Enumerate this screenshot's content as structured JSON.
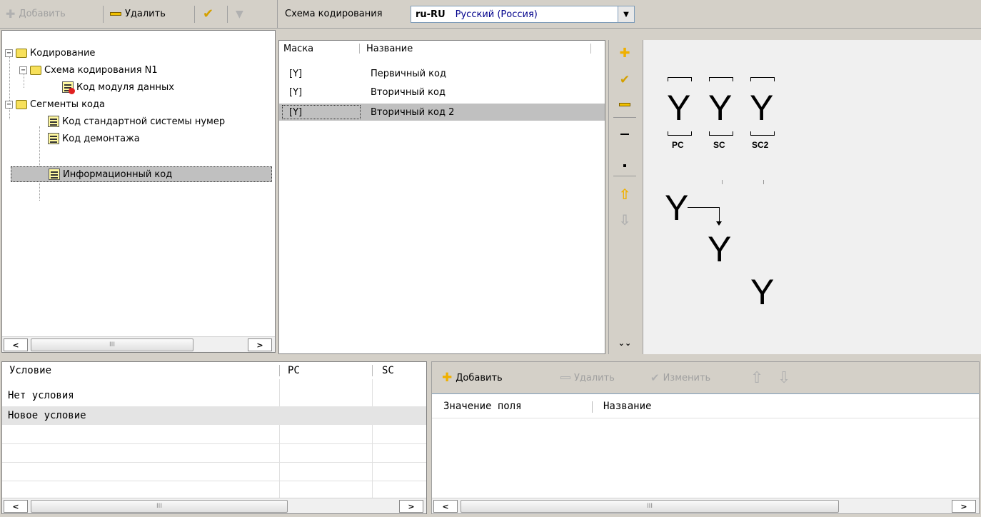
{
  "top_toolbar": {
    "add_label": "Добавить",
    "delete_label": "Удалить"
  },
  "scheme_bar": {
    "label": "Схема кодирования",
    "code": "ru-RU",
    "name": "Русский (Россия)"
  },
  "tree": {
    "items": [
      {
        "label": "Кодирование"
      },
      {
        "label": "Схема кодирования N1"
      },
      {
        "label": "Код модуля данных"
      },
      {
        "label": "Сегменты кода"
      },
      {
        "label": "Код стандартной системы нумер"
      },
      {
        "label": "Код демонтажа"
      },
      {
        "label": "Информационный код"
      }
    ],
    "scroll_grip": "III"
  },
  "mask_table": {
    "headers": {
      "mask": "Маска",
      "name": "Название"
    },
    "rows": [
      {
        "mask": "[Y]",
        "name": "Первичный код"
      },
      {
        "mask": "[Y]",
        "name": "Вторичный код"
      },
      {
        "mask": "[Y]",
        "name": "Вторичный код 2"
      }
    ]
  },
  "preview": {
    "glyph": "Y",
    "segments": [
      "PC",
      "SC",
      "SC2"
    ]
  },
  "conditions_table": {
    "headers": {
      "condition": "Условие",
      "pc": "PC",
      "sc": "SC"
    },
    "rows": [
      {
        "condition": "Нет условия"
      },
      {
        "condition": "Новое условие"
      }
    ],
    "scroll_grip": "III"
  },
  "values_panel": {
    "toolbar": {
      "add_label": "Добавить",
      "delete_label": "Удалить",
      "edit_label": "Изменить"
    },
    "headers": {
      "value": "Значение поля",
      "name": "Название"
    },
    "scroll_grip": "III"
  },
  "colors": {
    "selection": "#c0c0c0",
    "accent_yellow": "#f0c000",
    "scheme_name_blue": "#00008b"
  }
}
